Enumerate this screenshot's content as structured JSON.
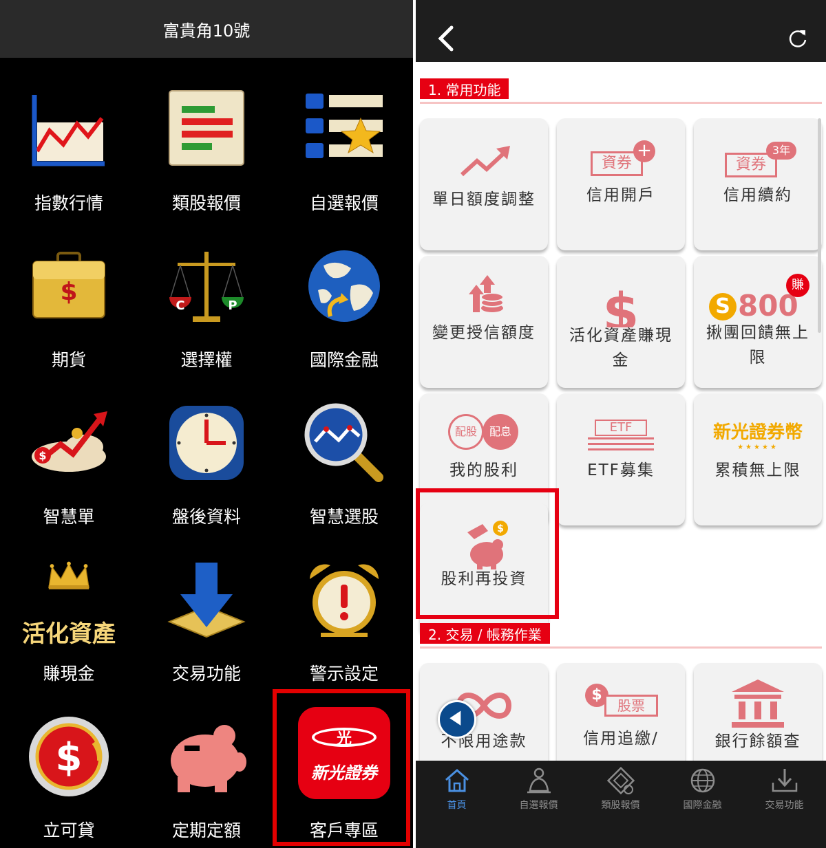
{
  "left": {
    "header_title": "富貴角10號",
    "tiles": [
      {
        "label": "指數行情",
        "icon": "index-chart-icon"
      },
      {
        "label": "類股報價",
        "icon": "sector-quote-icon"
      },
      {
        "label": "自選報價",
        "icon": "watchlist-star-icon"
      },
      {
        "label": "期貨",
        "icon": "briefcase-dollar-icon"
      },
      {
        "label": "選擇權",
        "icon": "scale-cp-icon"
      },
      {
        "label": "國際金融",
        "icon": "globe-icon"
      },
      {
        "label": "智慧單",
        "icon": "smart-order-icon"
      },
      {
        "label": "盤後資料",
        "icon": "clock-icon"
      },
      {
        "label": "智慧選股",
        "icon": "magnifier-chart-icon"
      },
      {
        "label": "賺現金",
        "icon": "crown-icon",
        "banner": "活化資產"
      },
      {
        "label": "交易功能",
        "icon": "download-arrow-icon"
      },
      {
        "label": "警示設定",
        "icon": "alarm-clock-icon"
      },
      {
        "label": "立可貸",
        "icon": "coin-dollar-icon"
      },
      {
        "label": "定期定額",
        "icon": "piggy-bank-icon"
      },
      {
        "label": "客戶專區",
        "icon": "skl-logo-icon",
        "logo_top": "光",
        "logo_bottom": "新光證券"
      }
    ]
  },
  "right": {
    "section1_title": "1. 常用功能",
    "section2_title": "2. 交易 / 帳務作業",
    "cards1": [
      {
        "label": "單日額度調整",
        "icon": "trend-up-icon"
      },
      {
        "label": "信用開戶",
        "icon": "securities-plus-icon",
        "tag": "資券",
        "badge": "+"
      },
      {
        "label": "信用續約",
        "icon": "securities-renew-icon",
        "tag": "資券",
        "badge": "3年"
      },
      {
        "label": "變更授信額度",
        "icon": "coins-arrow-icon"
      },
      {
        "label": "活化資產賺現金",
        "icon": "dollar-sign-icon"
      },
      {
        "label": "揪團回饋無上限",
        "icon": "coin-800-icon",
        "amount": "800",
        "coin": "S",
        "badge": "賺"
      },
      {
        "label": "我的股利",
        "icon": "dividend-icon",
        "tag1": "配股",
        "tag2": "配息"
      },
      {
        "label": "ETF募集",
        "icon": "etf-icon",
        "tag": "ETF"
      },
      {
        "label": "累積無上限",
        "icon": "skl-coin-icon",
        "banner": "新光證券幣"
      },
      {
        "label": "股利再投資",
        "icon": "piggy-coin-icon"
      }
    ],
    "cards2": [
      {
        "label": "不限用途款",
        "icon": "infinity-icon"
      },
      {
        "label": "信用追繳/",
        "icon": "stock-dollar-icon",
        "tag": "股票"
      },
      {
        "label": "銀行餘額查",
        "icon": "bank-icon"
      }
    ],
    "nav": [
      {
        "label": "首頁",
        "icon": "home-icon",
        "active": true
      },
      {
        "label": "自選報價",
        "icon": "watchlist-nav-icon"
      },
      {
        "label": "類股報價",
        "icon": "sector-nav-icon"
      },
      {
        "label": "國際金融",
        "icon": "globe-nav-icon"
      },
      {
        "label": "交易功能",
        "icon": "trade-nav-icon"
      }
    ]
  },
  "colors": {
    "accent_red": "#e60012",
    "card_icon": "#e0737a",
    "nav_active": "#4a90e2"
  }
}
